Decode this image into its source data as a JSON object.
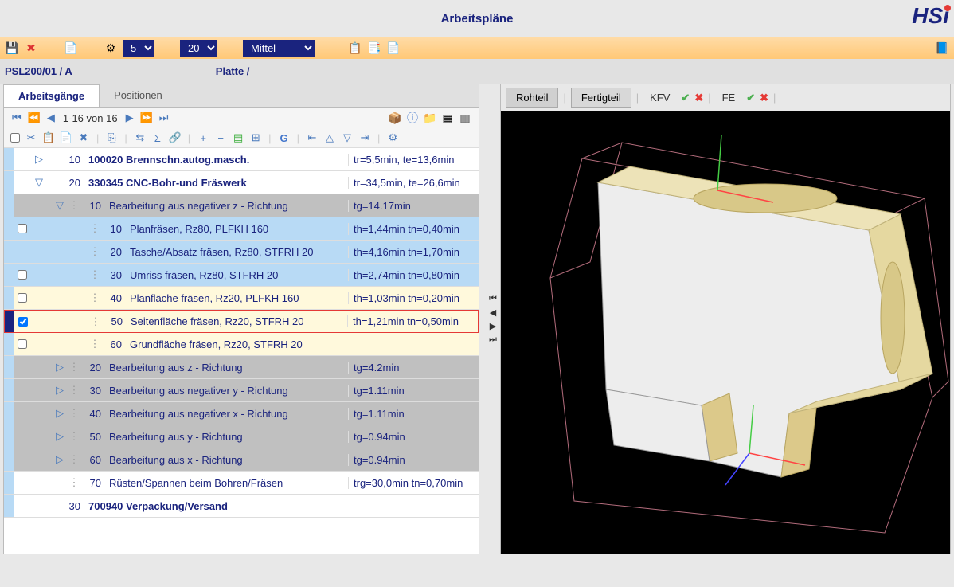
{
  "header": {
    "title": "Arbeitspläne",
    "logo": "HSi"
  },
  "toolbar1": {
    "select1": "5",
    "select2": "20",
    "select3": "Mittel"
  },
  "subheader": {
    "part": "PSL200/01 / A",
    "desc": "Platte /"
  },
  "tabs": {
    "tab1": "Arbeitsgänge",
    "tab2": "Positionen"
  },
  "nav": {
    "range": "1-16 von 16"
  },
  "rows": [
    {
      "marker": "blue",
      "bg": "white",
      "expand": "▷",
      "num": "10",
      "desc": "100020 Brennschn.autog.masch.",
      "bold": true,
      "time": "tr=5,5min, te=13,6min",
      "indent": 0
    },
    {
      "marker": "blue",
      "bg": "white",
      "expand": "▽",
      "num": "20",
      "desc": "330345 CNC-Bohr-und Fräswerk",
      "bold": true,
      "time": "tr=34,5min, te=26,6min",
      "indent": 0
    },
    {
      "marker": "blue",
      "bg": "gray",
      "expand": "▽",
      "num": "10",
      "desc": "Bearbeitung aus negativer z - Richtung",
      "time": "tg=14.17min",
      "indent": 1
    },
    {
      "marker": "blue",
      "bg": "blue",
      "check": true,
      "num": "10",
      "desc": "Planfräsen, Rz80, PLFKH 160",
      "time": "th=1,44min tn=0,40min",
      "indent": 2
    },
    {
      "marker": "blue",
      "bg": "blue",
      "num": "20",
      "desc": "Tasche/Absatz fräsen, Rz80, STFRH 20",
      "time": "th=4,16min tn=1,70min",
      "indent": 2
    },
    {
      "marker": "blue",
      "bg": "blue",
      "check": true,
      "num": "30",
      "desc": "Umriss fräsen, Rz80, STFRH 20",
      "time": "th=2,74min tn=0,80min",
      "indent": 2
    },
    {
      "marker": "blue",
      "bg": "yellow",
      "check": true,
      "num": "40",
      "desc": "Planfläche fräsen, Rz20, PLFKH 160",
      "time": "th=1,03min tn=0,20min",
      "indent": 2
    },
    {
      "marker": "sel",
      "bg": "yellow",
      "check": true,
      "checked": true,
      "selected": true,
      "num": "50",
      "desc": "Seitenfläche fräsen, Rz20, STFRH 20",
      "time": "th=1,21min tn=0,50min",
      "indent": 2
    },
    {
      "marker": "blue",
      "bg": "yellow",
      "check": true,
      "num": "60",
      "desc": "Grundfläche fräsen, Rz20, STFRH 20",
      "time": "",
      "indent": 2
    },
    {
      "marker": "blue",
      "bg": "gray",
      "expand": "▷",
      "num": "20",
      "desc": "Bearbeitung aus z - Richtung",
      "time": "tg=4.2min",
      "indent": 1
    },
    {
      "marker": "blue",
      "bg": "gray",
      "expand": "▷",
      "num": "30",
      "desc": "Bearbeitung aus negativer y - Richtung",
      "time": "tg=1.11min",
      "indent": 1
    },
    {
      "marker": "blue",
      "bg": "gray",
      "expand": "▷",
      "num": "40",
      "desc": "Bearbeitung aus negativer x - Richtung",
      "time": "tg=1.11min",
      "indent": 1
    },
    {
      "marker": "blue",
      "bg": "gray",
      "expand": "▷",
      "num": "50",
      "desc": "Bearbeitung aus y - Richtung",
      "time": "tg=0.94min",
      "indent": 1
    },
    {
      "marker": "blue",
      "bg": "gray",
      "expand": "▷",
      "num": "60",
      "desc": "Bearbeitung aus x - Richtung",
      "time": "tg=0.94min",
      "indent": 1
    },
    {
      "marker": "blue",
      "bg": "white",
      "num": "70",
      "desc": "Rüsten/Spannen beim Bohren/Fräsen",
      "time": "trg=30,0min tn=0,70min",
      "indent": 1
    },
    {
      "marker": "blue",
      "bg": "white",
      "num": "30",
      "desc": "700940 Verpackung/Versand",
      "bold": true,
      "time": "",
      "indent": 0
    }
  ],
  "viewer": {
    "tab1": "Rohteil",
    "tab2": "Fertigteil",
    "label1": "KFV",
    "label2": "FE"
  }
}
